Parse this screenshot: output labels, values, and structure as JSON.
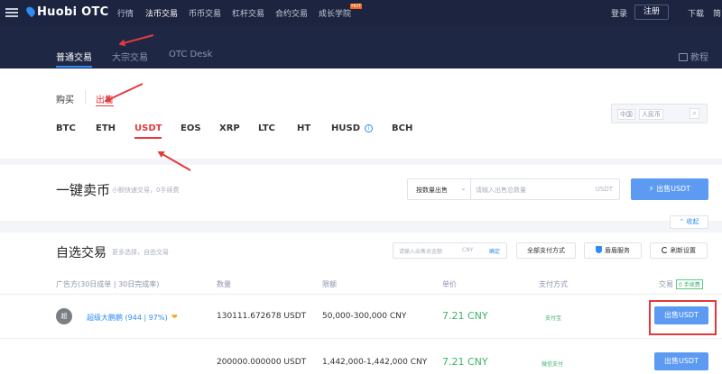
{
  "topbar": {
    "logo": "Huobi OTC",
    "nav": [
      {
        "label": "行情"
      },
      {
        "label": "法币交易",
        "active": true
      },
      {
        "label": "币币交易"
      },
      {
        "label": "杠杆交易"
      },
      {
        "label": "合约交易"
      },
      {
        "label": "成长学院",
        "badge": "HOT"
      }
    ],
    "login": "登录",
    "register": "注册",
    "download": "下载",
    "language": "简"
  },
  "subnav": {
    "tabs": [
      {
        "label": "普通交易",
        "active": true
      },
      {
        "label": "大宗交易"
      },
      {
        "label": "OTC Desk"
      }
    ],
    "guide": "教程"
  },
  "trade": {
    "buy": "购买",
    "sell": "出售",
    "coins": [
      "BTC",
      "ETH",
      "USDT",
      "EOS",
      "XRP",
      "LTC",
      "HT",
      "HUSD",
      "BCH"
    ],
    "active_coin": "USDT",
    "region": "中国",
    "currency": "人民币"
  },
  "quick_sell": {
    "title": "一键卖币",
    "subtitle": "小额快速交易，0手续费",
    "mode": "按数量出售",
    "input_placeholder": "请输入出售总数量",
    "unit": "USDT",
    "button": "出售USDT",
    "collapse": "收起"
  },
  "self_select": {
    "title": "自选交易",
    "subtitle": "更多选择，自由交易",
    "amount_placeholder": "请输入出售总金额",
    "amount_unit": "CNY",
    "confirm": "确定",
    "all_payment": "全部支付方式",
    "escrow": "盾盾服务",
    "refresh": "刷新设置",
    "columns": {
      "merchant": "广告方(30日成单 | 30日完成率)",
      "quantity": "数量",
      "limit": "限额",
      "price": "单价",
      "payment": "支付方式",
      "trade": "交易",
      "fee": "0 手续费"
    },
    "rows": [
      {
        "avatar": "超",
        "merchant": "超级大鹏鹏",
        "stats": "(944 | 97%)",
        "quantity": "130111.672678 USDT",
        "limit": "50,000-300,000 CNY",
        "price": "7.21 CNY",
        "payment": "支付宝",
        "action": "出售USDT"
      },
      {
        "avatar": "",
        "merchant": "",
        "stats": "",
        "quantity": "200000.000000 USDT",
        "limit": "1,442,000-1,442,000 CNY",
        "price": "7.21 CNY",
        "payment": "微信支付",
        "action": "出售USDT"
      }
    ]
  },
  "colors": {
    "accent": "#2f8cf5",
    "sell_red": "#e4393c",
    "price_green": "#3bb36b",
    "header_bg": "#1c2440"
  }
}
